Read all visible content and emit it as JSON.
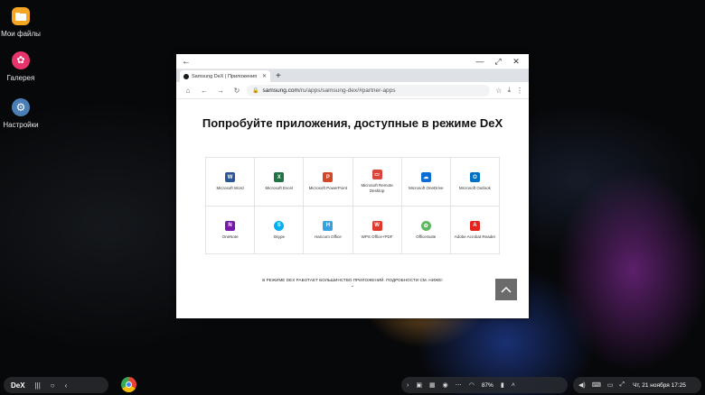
{
  "desktop": {
    "icons": [
      {
        "label": "Мои файлы",
        "color": "#f5a623"
      },
      {
        "label": "Галерея",
        "color": "#e8336b"
      },
      {
        "label": "Настройки",
        "color": "#4a7fb5"
      }
    ]
  },
  "browser": {
    "tab_title": "Samsung DeX | Приложения",
    "url_host": "samsung.com",
    "url_path": "/ru/apps/samsung-dex/#partner-apps",
    "page_title": "Попробуйте приложения, доступные в режиме DeX",
    "apps": [
      {
        "name": "Microsoft Word",
        "color": "#2b579a",
        "glyph": "W"
      },
      {
        "name": "Microsoft Excel",
        "color": "#217346",
        "glyph": "X"
      },
      {
        "name": "Microsoft PowerPoint",
        "color": "#d24726",
        "glyph": "P"
      },
      {
        "name": "Microsoft Remote Desktop",
        "color": "#d8453a",
        "glyph": "▭"
      },
      {
        "name": "Microsoft OneDrive",
        "color": "#0a6cd4",
        "glyph": "☁"
      },
      {
        "name": "Microsoft Outlook",
        "color": "#0072c6",
        "glyph": "O"
      },
      {
        "name": "OneNote",
        "color": "#7719aa",
        "glyph": "N"
      },
      {
        "name": "Skype",
        "color": "#00aff0",
        "glyph": "S"
      },
      {
        "name": "Hancom Office",
        "color": "#3aa0e0",
        "glyph": "H"
      },
      {
        "name": "WPS Office+PDF",
        "color": "#e0392b",
        "glyph": "W"
      },
      {
        "name": "OfficeSuite",
        "color": "#5cb85c",
        "glyph": "✿"
      },
      {
        "name": "Adobe Acrobat Reader",
        "color": "#e5251b",
        "glyph": "A"
      }
    ],
    "footer_note": "В РЕЖИМЕ DEX РАБОТАЕТ БОЛЬШИНСТВО ПРИЛОЖЕНИЙ. ПОДРОБНОСТИ СМ. НИЖЕ!"
  },
  "taskbar": {
    "dex_label": "DeX",
    "battery": "87%",
    "clock": "Чт, 21 ноября 17:25"
  }
}
